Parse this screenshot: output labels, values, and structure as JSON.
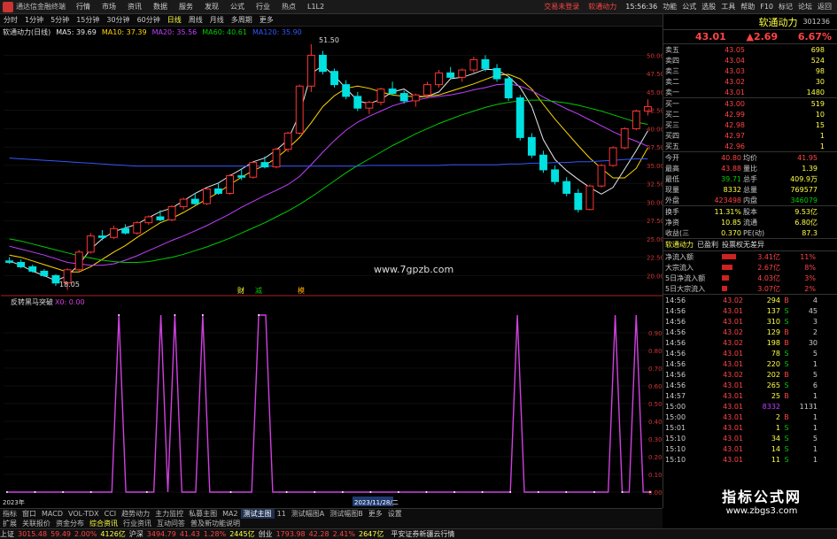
{
  "topbar": {
    "title": "通达信金融终端",
    "menu": [
      "行情",
      "市场",
      "资讯",
      "数据",
      "服务",
      "发现",
      "公式",
      "行业",
      "热点",
      "L1L2"
    ],
    "warn": "交易未登录",
    "warn2": "软通动力",
    "right": [
      "功能",
      "公式",
      "选股",
      "工具",
      "帮助",
      "F10",
      "标记",
      "论坛",
      "返回"
    ],
    "clock": "15:56:36"
  },
  "timeframes": {
    "items": [
      "分时",
      "1分钟",
      "5分钟",
      "15分钟",
      "30分钟",
      "60分钟",
      "日线",
      "周线",
      "月线",
      "多周期",
      "更多"
    ],
    "active": "日线"
  },
  "ma": {
    "name": "软通动力(日线)",
    "ma5": "MA5: 39.69",
    "ma10": "MA10: 37.39",
    "ma20": "MA20: 35.56",
    "ma60": "MA60: 40.61",
    "ma120": "MA120: 35.90"
  },
  "chart_labels": {
    "high": "51.50",
    "low": "18.05",
    "watermark": "www.7gpzb.com",
    "ind_name": "反转黑马突破",
    "ind_val": "X0: 0.00",
    "marks": [
      "财",
      "减",
      "模"
    ],
    "date_label": "2023/11/28/二",
    "year_label": "2023年",
    "cursor_val": "0.99"
  },
  "colors": {
    "up": "#ff3333",
    "down": "#00e0e0",
    "ma5": "#e8e8e8",
    "ma10": "#ffd700",
    "ma20": "#c040ff",
    "ma60": "#00cc00",
    "ma120": "#3355ff",
    "indicator": "#d040e0"
  },
  "chart_data": [
    {
      "type": "line",
      "title": "软通动力(日线)",
      "xlabel": "",
      "ylabel": "",
      "ylim": [
        18,
        51.5
      ],
      "y_ticks": [
        20,
        22.5,
        25,
        27.5,
        30,
        32.5,
        35,
        37.5,
        40,
        42.5,
        45,
        47.5,
        50
      ],
      "series": [
        {
          "name": "MA5",
          "values": [
            22.0,
            21.4,
            20.6,
            20.0,
            19.3,
            20.0,
            21.5,
            23.6,
            25.0,
            26.0,
            26.5,
            27.0,
            27.9,
            28.7,
            29.2,
            30.2,
            31.2,
            32.0,
            32.6,
            33.6,
            34.5,
            35.5,
            36.0,
            37.1,
            38.5,
            42.0,
            47.5,
            48.6,
            47.2,
            45.5,
            43.8,
            43.4,
            44.0,
            45.0,
            45.4,
            44.3,
            44.4,
            45.0,
            46.8,
            47.0,
            47.5,
            48.1,
            48.0,
            47.1,
            45.6,
            43.0,
            38.5,
            35.8,
            34.3,
            33.1,
            32.0,
            31.1,
            32.0,
            34.5,
            37.0,
            39.7
          ]
        },
        {
          "name": "MA10",
          "values": [
            22.8,
            22.5,
            22.0,
            21.5,
            21.0,
            20.5,
            20.5,
            21.2,
            22.2,
            23.2,
            24.1,
            25.2,
            26.2,
            27.2,
            27.8,
            28.6,
            29.5,
            30.4,
            31.3,
            32.4,
            33.4,
            34.3,
            35.0,
            36.0,
            37.3,
            38.8,
            40.8,
            43.0,
            44.5,
            45.5,
            45.8,
            45.5,
            45.0,
            44.6,
            44.4,
            44.4,
            44.4,
            44.6,
            45.1,
            45.6,
            46.1,
            46.7,
            47.3,
            47.4,
            46.8,
            45.4,
            43.3,
            41.3,
            39.5,
            37.7,
            36.0,
            34.6,
            33.3,
            33.3,
            34.6,
            37.4
          ]
        },
        {
          "name": "MA20",
          "values": [
            24.0,
            23.6,
            23.2,
            22.8,
            22.3,
            21.8,
            21.6,
            21.4,
            21.4,
            21.6,
            22.1,
            22.7,
            23.4,
            24.1,
            24.8,
            25.4,
            26.1,
            26.8,
            27.6,
            28.4,
            29.3,
            30.1,
            30.9,
            31.6,
            32.4,
            33.5,
            35.1,
            36.8,
            38.4,
            39.8,
            40.9,
            41.7,
            42.4,
            43.1,
            43.6,
            43.9,
            44.2,
            44.4,
            44.6,
            44.9,
            45.3,
            45.6,
            46.0,
            46.1,
            45.8,
            45.2,
            44.3,
            43.5,
            42.7,
            42.0,
            41.2,
            40.4,
            39.6,
            38.9,
            38.3,
            37.6
          ]
        },
        {
          "name": "MA60",
          "values": [
            25.0,
            24.7,
            24.3,
            23.9,
            23.5,
            23.1,
            22.7,
            22.4,
            22.1,
            21.9,
            21.8,
            21.8,
            21.9,
            22.2,
            22.5,
            22.9,
            23.4,
            23.9,
            24.5,
            25.1,
            25.8,
            26.5,
            27.2,
            28.0,
            28.8,
            29.7,
            30.7,
            31.8,
            32.9,
            34.0,
            35.0,
            35.9,
            36.8,
            37.7,
            38.5,
            39.3,
            40.0,
            40.7,
            41.3,
            41.9,
            42.4,
            42.9,
            43.3,
            43.6,
            43.8,
            43.9,
            43.9,
            43.7,
            43.5,
            43.2,
            42.8,
            42.4,
            41.9,
            41.4,
            40.9,
            40.6
          ]
        },
        {
          "name": "MA120",
          "values": [
            36.0,
            35.9,
            35.8,
            35.7,
            35.6,
            35.5,
            35.4,
            35.3,
            35.2,
            35.1,
            35.0,
            34.9,
            34.9,
            34.9,
            34.9,
            34.9,
            34.9,
            34.9,
            34.9,
            34.9,
            34.9,
            34.9,
            34.9,
            34.9,
            34.9,
            34.9,
            34.9,
            34.9,
            34.9,
            34.9,
            34.9,
            35.0,
            35.0,
            35.0,
            35.0,
            35.0,
            35.0,
            35.0,
            35.1,
            35.1,
            35.1,
            35.1,
            35.1,
            35.2,
            35.2,
            35.3,
            35.3,
            35.4,
            35.4,
            35.5,
            35.5,
            35.6,
            35.7,
            35.8,
            35.9,
            35.9
          ]
        }
      ],
      "candles": [
        [
          22.0,
          22.5,
          21.6,
          21.8
        ],
        [
          21.8,
          22.2,
          21.0,
          21.2
        ],
        [
          21.2,
          21.5,
          20.4,
          20.6
        ],
        [
          20.6,
          20.9,
          19.8,
          20.0
        ],
        [
          20.0,
          20.2,
          18.6,
          19.0
        ],
        [
          19.0,
          21.0,
          18.05,
          20.8
        ],
        [
          20.8,
          23.5,
          20.6,
          23.2
        ],
        [
          23.2,
          25.8,
          23.0,
          25.4
        ],
        [
          25.4,
          26.2,
          24.8,
          25.2
        ],
        [
          25.2,
          26.8,
          25.0,
          26.4
        ],
        [
          26.4,
          27.0,
          25.6,
          25.8
        ],
        [
          25.8,
          27.4,
          25.6,
          27.2
        ],
        [
          27.2,
          28.2,
          26.9,
          28.0
        ],
        [
          28.0,
          28.9,
          27.4,
          27.6
        ],
        [
          27.6,
          29.6,
          27.4,
          29.4
        ],
        [
          29.4,
          30.6,
          29.0,
          30.4
        ],
        [
          30.4,
          31.2,
          29.6,
          29.8
        ],
        [
          29.8,
          32.0,
          29.6,
          31.8
        ],
        [
          31.8,
          32.6,
          31.0,
          31.2
        ],
        [
          31.2,
          33.8,
          31.0,
          33.6
        ],
        [
          33.6,
          34.6,
          33.0,
          33.4
        ],
        [
          33.4,
          35.6,
          33.2,
          35.4
        ],
        [
          35.4,
          36.2,
          34.6,
          34.8
        ],
        [
          34.8,
          37.4,
          34.6,
          37.2
        ],
        [
          37.2,
          39.6,
          36.8,
          39.4
        ],
        [
          39.4,
          46.0,
          39.2,
          45.8
        ],
        [
          45.8,
          51.5,
          45.0,
          50.0
        ],
        [
          50.0,
          50.6,
          47.4,
          47.8
        ],
        [
          47.8,
          48.2,
          45.6,
          46.0
        ],
        [
          46.0,
          46.6,
          44.0,
          44.4
        ],
        [
          44.4,
          45.0,
          42.4,
          42.8
        ],
        [
          42.8,
          43.8,
          42.0,
          43.6
        ],
        [
          43.6,
          45.6,
          43.2,
          45.4
        ],
        [
          45.4,
          46.4,
          44.6,
          44.8
        ],
        [
          44.8,
          45.2,
          43.4,
          43.8
        ],
        [
          43.8,
          44.8,
          43.0,
          44.6
        ],
        [
          44.6,
          46.4,
          44.2,
          46.0
        ],
        [
          46.0,
          48.0,
          45.6,
          47.6
        ],
        [
          47.6,
          48.4,
          46.8,
          47.0
        ],
        [
          47.0,
          48.2,
          46.4,
          48.0
        ],
        [
          48.0,
          49.8,
          47.6,
          49.4
        ],
        [
          49.4,
          50.0,
          47.8,
          48.2
        ],
        [
          48.2,
          48.8,
          46.4,
          46.8
        ],
        [
          46.8,
          47.2,
          43.8,
          44.2
        ],
        [
          44.2,
          44.6,
          38.4,
          38.8
        ],
        [
          38.8,
          39.4,
          36.0,
          36.4
        ],
        [
          36.4,
          37.0,
          34.0,
          34.4
        ],
        [
          34.4,
          35.0,
          32.4,
          32.8
        ],
        [
          32.8,
          33.4,
          30.8,
          31.2
        ],
        [
          31.2,
          31.8,
          28.6,
          29.0
        ],
        [
          29.0,
          32.4,
          28.9,
          32.2
        ],
        [
          32.2,
          35.2,
          32.0,
          35.0
        ],
        [
          35.0,
          37.6,
          34.8,
          37.4
        ],
        [
          37.4,
          40.2,
          37.2,
          40.0
        ],
        [
          40.0,
          42.6,
          39.8,
          42.4
        ],
        [
          42.4,
          44.0,
          41.8,
          43.0
        ]
      ]
    },
    {
      "type": "line",
      "title": "反转黑马突破",
      "xlabel": "",
      "ylabel": "",
      "ylim": [
        0,
        1
      ],
      "y_ticks": [
        0,
        0.1,
        0.2,
        0.3,
        0.4,
        0.5,
        0.6,
        0.7,
        0.8,
        0.9
      ],
      "series": [
        {
          "name": "X0",
          "values": [
            0,
            0,
            0,
            0,
            0,
            0,
            0,
            0,
            0,
            0,
            0,
            0,
            0,
            0,
            0,
            0,
            1,
            0,
            0,
            0,
            0,
            0,
            1,
            0,
            1,
            0,
            0,
            0,
            1,
            0,
            0,
            0,
            0,
            0,
            0,
            0,
            1,
            1,
            0,
            0,
            0,
            0,
            0,
            0,
            0,
            0,
            0,
            0,
            0,
            0,
            0,
            0,
            0,
            0,
            0,
            0,
            0,
            0,
            0,
            0,
            0,
            0,
            0,
            0,
            0,
            0,
            0,
            0,
            0,
            0,
            0,
            0,
            0,
            1,
            0,
            0,
            0,
            0,
            0,
            0,
            0,
            0,
            0,
            0,
            0,
            0,
            0,
            1,
            0,
            0,
            1,
            0,
            0
          ]
        }
      ]
    }
  ],
  "right": {
    "name": "软通动力",
    "code": "301236",
    "price": "43.01",
    "chg": "▲2.69",
    "pct": "6.67%",
    "asks": [
      [
        "卖五",
        "43.05",
        "698"
      ],
      [
        "卖四",
        "43.04",
        "524"
      ],
      [
        "卖三",
        "43.03",
        "98"
      ],
      [
        "卖二",
        "43.02",
        "30"
      ],
      [
        "卖一",
        "43.01",
        "1480"
      ]
    ],
    "bids": [
      [
        "买一",
        "43.00",
        "519"
      ],
      [
        "买二",
        "42.99",
        "10"
      ],
      [
        "买三",
        "42.98",
        "15"
      ],
      [
        "买四",
        "42.97",
        "1"
      ],
      [
        "买五",
        "42.96",
        "1"
      ]
    ],
    "stats": [
      [
        "今开",
        "40.80",
        "均价",
        "41.95"
      ],
      [
        "最高",
        "43.88",
        "量比",
        "1.39"
      ],
      [
        "最低",
        "39.71",
        "总手",
        "409.9万"
      ],
      [
        "现量",
        "8332",
        "总量",
        "769577"
      ],
      [
        "外盘",
        "423498",
        "内盘",
        "346079"
      ]
    ],
    "stats2": [
      [
        "换手",
        "11.31%",
        "股本",
        "9.53亿"
      ],
      [
        "净资",
        "10.85",
        "流通",
        "6.80亿"
      ],
      [
        "收益(三)",
        "0.370",
        "PE(动)",
        "87.3"
      ]
    ],
    "levels": [
      "软通动力",
      "已盈利",
      "投票权无差异"
    ],
    "flows": [
      [
        "净流入额",
        "3.41亿",
        "11%"
      ],
      [
        "大宗流入",
        "2.67亿",
        "8%"
      ],
      [
        "5日净流入额",
        "4.03亿",
        "3%"
      ],
      [
        "5日大宗流入",
        "3.07亿",
        "2%"
      ]
    ],
    "ticks": [
      [
        "14:56",
        "43.02",
        "294",
        "B",
        "4"
      ],
      [
        "14:56",
        "43.01",
        "137",
        "S",
        "45"
      ],
      [
        "14:56",
        "43.01",
        "310",
        "S",
        "3"
      ],
      [
        "14:56",
        "43.02",
        "129",
        "B",
        "2"
      ],
      [
        "14:56",
        "43.02",
        "198",
        "B",
        "30"
      ],
      [
        "14:56",
        "43.01",
        "78",
        "S",
        "5"
      ],
      [
        "14:56",
        "43.01",
        "220",
        "S",
        "1"
      ],
      [
        "14:56",
        "43.02",
        "202",
        "B",
        "5"
      ],
      [
        "14:56",
        "43.01",
        "265",
        "S",
        "6"
      ],
      [
        "14:57",
        "43.01",
        "25",
        "B",
        "1"
      ],
      [
        "15:00",
        "43.01",
        "8332",
        "",
        "1131"
      ],
      [
        "15:00",
        "43.01",
        "2",
        "B",
        "1"
      ],
      [
        "15:01",
        "43.01",
        "1",
        "S",
        "1"
      ],
      [
        "15:10",
        "43.01",
        "34",
        "S",
        "5"
      ],
      [
        "15:10",
        "43.01",
        "14",
        "S",
        "1"
      ],
      [
        "15:10",
        "43.01",
        "11",
        "S",
        "1"
      ]
    ]
  },
  "footer": {
    "brand": "指标公式网",
    "url": "www.zbgs3.com"
  },
  "indicator_tabs": {
    "items": [
      "指标",
      "窗口",
      "MACD",
      "VOL-TDX",
      "CCI",
      "趋势动力",
      "主力监控",
      "私募主图",
      "MA2",
      "测试主图",
      "11",
      "测试幅图A",
      "测试幅图B",
      "更多",
      "设置"
    ],
    "active": "测试主图"
  },
  "sub_tabs": {
    "items": [
      "扩展",
      "关联报价",
      "资金分布",
      "综合资讯",
      "行业资讯",
      "互动问答",
      "普及新功能说明"
    ],
    "active": "综合资讯"
  },
  "status": {
    "sh": "上证",
    "sh_val": "3015.48",
    "sh_chg": "59.49",
    "sh_pct": "2.00%",
    "sh_vol": "4126亿",
    "sz": "沪深",
    "sz_val": "3494.79",
    "sz_chg": "41.43",
    "sz_pct": "1.28%",
    "sz_vol": "2445亿",
    "cy": "创业",
    "cy_val": "1793.98",
    "cy_chg": "42.28",
    "cy_pct": "2.41%",
    "cy_vol": "2647亿",
    "server": "平安证券新疆云行情"
  }
}
